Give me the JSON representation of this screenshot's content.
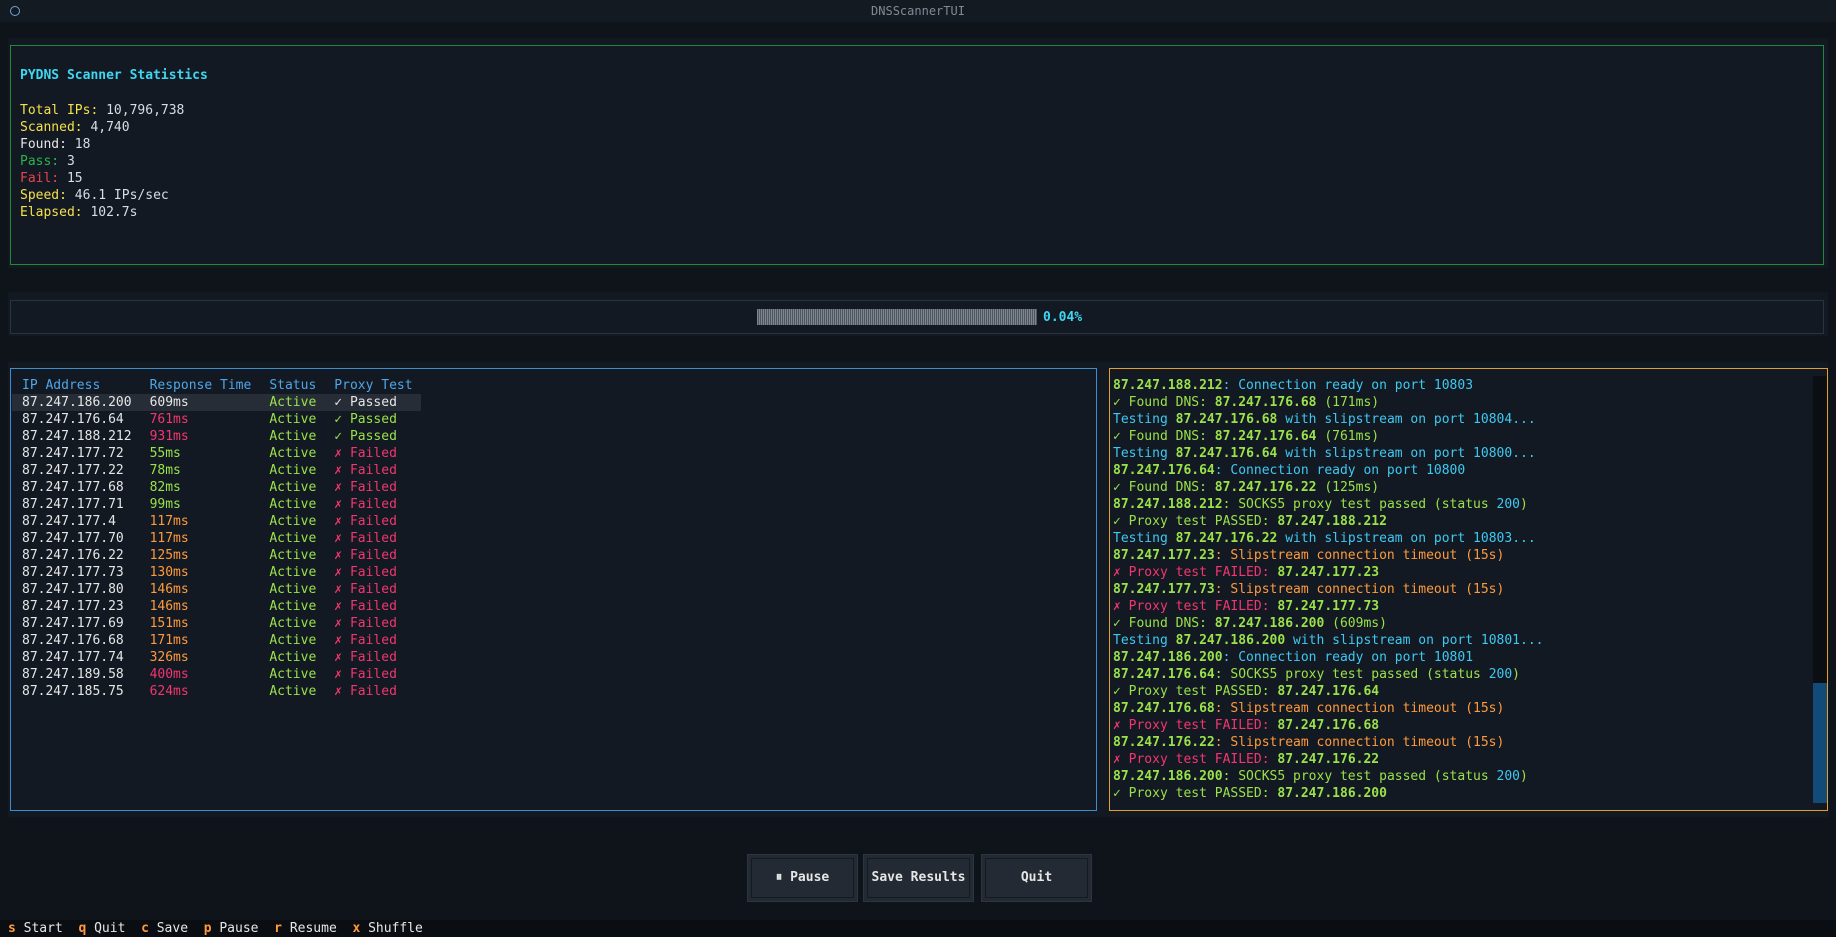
{
  "window": {
    "title": "DNSScannerTUI"
  },
  "stats": {
    "title": "PYDNS Scanner Statistics",
    "total_label": "Total IPs:",
    "total_value": "10,796,738",
    "scanned_label": "Scanned:",
    "scanned_value": "4,740",
    "found_label": "Found:",
    "found_value": "18",
    "pass_label": "Pass:",
    "pass_value": "3",
    "fail_label": "Fail:",
    "fail_value": "15",
    "speed_label": "Speed:",
    "speed_value": "46.1 IPs/sec",
    "elapsed_label": "Elapsed:",
    "elapsed_value": "102.7s"
  },
  "progress": {
    "percent_text": "0.04%",
    "fraction": 0.0004
  },
  "table": {
    "headers": [
      "IP Address",
      "Response Time",
      "Status",
      "Proxy Test"
    ],
    "rows": [
      {
        "ip": "87.247.186.200",
        "rt": "609ms",
        "rt_level": "white",
        "status": "Active",
        "proxy": "✓ Passed",
        "ok": true
      },
      {
        "ip": "87.247.176.64",
        "rt": "761ms",
        "rt_level": "red",
        "status": "Active",
        "proxy": "✓ Passed",
        "ok": true
      },
      {
        "ip": "87.247.188.212",
        "rt": "931ms",
        "rt_level": "red",
        "status": "Active",
        "proxy": "✓ Passed",
        "ok": true
      },
      {
        "ip": "87.247.177.72",
        "rt": "55ms",
        "rt_level": "green",
        "status": "Active",
        "proxy": "✗ Failed",
        "ok": false
      },
      {
        "ip": "87.247.177.22",
        "rt": "78ms",
        "rt_level": "green",
        "status": "Active",
        "proxy": "✗ Failed",
        "ok": false
      },
      {
        "ip": "87.247.177.68",
        "rt": "82ms",
        "rt_level": "green",
        "status": "Active",
        "proxy": "✗ Failed",
        "ok": false
      },
      {
        "ip": "87.247.177.71",
        "rt": "99ms",
        "rt_level": "green",
        "status": "Active",
        "proxy": "✗ Failed",
        "ok": false
      },
      {
        "ip": "87.247.177.4",
        "rt": "117ms",
        "rt_level": "orange",
        "status": "Active",
        "proxy": "✗ Failed",
        "ok": false
      },
      {
        "ip": "87.247.177.70",
        "rt": "117ms",
        "rt_level": "orange",
        "status": "Active",
        "proxy": "✗ Failed",
        "ok": false
      },
      {
        "ip": "87.247.176.22",
        "rt": "125ms",
        "rt_level": "orange",
        "status": "Active",
        "proxy": "✗ Failed",
        "ok": false
      },
      {
        "ip": "87.247.177.73",
        "rt": "130ms",
        "rt_level": "orange",
        "status": "Active",
        "proxy": "✗ Failed",
        "ok": false
      },
      {
        "ip": "87.247.177.80",
        "rt": "146ms",
        "rt_level": "orange",
        "status": "Active",
        "proxy": "✗ Failed",
        "ok": false
      },
      {
        "ip": "87.247.177.23",
        "rt": "146ms",
        "rt_level": "orange",
        "status": "Active",
        "proxy": "✗ Failed",
        "ok": false
      },
      {
        "ip": "87.247.177.69",
        "rt": "151ms",
        "rt_level": "orange",
        "status": "Active",
        "proxy": "✗ Failed",
        "ok": false
      },
      {
        "ip": "87.247.176.68",
        "rt": "171ms",
        "rt_level": "orange",
        "status": "Active",
        "proxy": "✗ Failed",
        "ok": false
      },
      {
        "ip": "87.247.177.74",
        "rt": "326ms",
        "rt_level": "orange",
        "status": "Active",
        "proxy": "✗ Failed",
        "ok": false
      },
      {
        "ip": "87.247.189.58",
        "rt": "400ms",
        "rt_level": "red",
        "status": "Active",
        "proxy": "✗ Failed",
        "ok": false
      },
      {
        "ip": "87.247.185.75",
        "rt": "624ms",
        "rt_level": "red",
        "status": "Active",
        "proxy": "✗ Failed",
        "ok": false
      }
    ]
  },
  "log": [
    [
      [
        "ip",
        "87.247.188.212"
      ],
      [
        "blue",
        ": Connection ready on port "
      ],
      [
        "num",
        "10803"
      ]
    ],
    [
      [
        "green",
        "✓ Found DNS: "
      ],
      [
        "ip",
        "87.247.176.68"
      ],
      [
        "green",
        " (171ms)"
      ]
    ],
    [
      [
        "blue",
        "Testing "
      ],
      [
        "ip",
        "87.247.176.68"
      ],
      [
        "blue",
        " with slipstream on port "
      ],
      [
        "num",
        "10804"
      ],
      [
        "blue",
        "..."
      ]
    ],
    [
      [
        "green",
        "✓ Found DNS: "
      ],
      [
        "ip",
        "87.247.176.64"
      ],
      [
        "green",
        " (761ms)"
      ]
    ],
    [
      [
        "blue",
        "Testing "
      ],
      [
        "ip",
        "87.247.176.64"
      ],
      [
        "blue",
        " with slipstream on port "
      ],
      [
        "num",
        "10800"
      ],
      [
        "blue",
        "..."
      ]
    ],
    [
      [
        "ip",
        "87.247.176.64"
      ],
      [
        "blue",
        ": Connection ready on port "
      ],
      [
        "num",
        "10800"
      ]
    ],
    [
      [
        "green",
        "✓ Found DNS: "
      ],
      [
        "ip",
        "87.247.176.22"
      ],
      [
        "green",
        " (125ms)"
      ]
    ],
    [
      [
        "ip",
        "87.247.188.212"
      ],
      [
        "green",
        ": SOCKS5 proxy test passed (status "
      ],
      [
        "num",
        "200"
      ],
      [
        "green",
        ")"
      ]
    ],
    [
      [
        "green",
        "✓ Proxy test PASSED: "
      ],
      [
        "ip",
        "87.247.188.212"
      ]
    ],
    [
      [
        "blue",
        "Testing "
      ],
      [
        "ip",
        "87.247.176.22"
      ],
      [
        "blue",
        " with slipstream on port "
      ],
      [
        "num",
        "10803"
      ],
      [
        "blue",
        "..."
      ]
    ],
    [
      [
        "ip",
        "87.247.177.23"
      ],
      [
        "orange",
        ": Slipstream connection timeout (15s)"
      ]
    ],
    [
      [
        "pink",
        "✗ Proxy test FAILED: "
      ],
      [
        "ip",
        "87.247.177.23"
      ]
    ],
    [
      [
        "ip",
        "87.247.177.73"
      ],
      [
        "orange",
        ": Slipstream connection timeout (15s)"
      ]
    ],
    [
      [
        "pink",
        "✗ Proxy test FAILED: "
      ],
      [
        "ip",
        "87.247.177.73"
      ]
    ],
    [
      [
        "green",
        "✓ Found DNS: "
      ],
      [
        "ip",
        "87.247.186.200"
      ],
      [
        "green",
        " (609ms)"
      ]
    ],
    [
      [
        "blue",
        "Testing "
      ],
      [
        "ip",
        "87.247.186.200"
      ],
      [
        "blue",
        " with slipstream on port "
      ],
      [
        "num",
        "10801"
      ],
      [
        "blue",
        "..."
      ]
    ],
    [
      [
        "ip",
        "87.247.186.200"
      ],
      [
        "blue",
        ": Connection ready on port "
      ],
      [
        "num",
        "10801"
      ]
    ],
    [
      [
        "ip",
        "87.247.176.64"
      ],
      [
        "green",
        ": SOCKS5 proxy test passed (status "
      ],
      [
        "num",
        "200"
      ],
      [
        "green",
        ")"
      ]
    ],
    [
      [
        "green",
        "✓ Proxy test PASSED: "
      ],
      [
        "ip",
        "87.247.176.64"
      ]
    ],
    [
      [
        "ip",
        "87.247.176.68"
      ],
      [
        "orange",
        ": Slipstream connection timeout (15s)"
      ]
    ],
    [
      [
        "pink",
        "✗ Proxy test FAILED: "
      ],
      [
        "ip",
        "87.247.176.68"
      ]
    ],
    [
      [
        "ip",
        "87.247.176.22"
      ],
      [
        "orange",
        ": Slipstream connection timeout (15s)"
      ]
    ],
    [
      [
        "pink",
        "✗ Proxy test FAILED: "
      ],
      [
        "ip",
        "87.247.176.22"
      ]
    ],
    [
      [
        "ip",
        "87.247.186.200"
      ],
      [
        "green",
        ": SOCKS5 proxy test passed (status "
      ],
      [
        "num",
        "200"
      ],
      [
        "green",
        ")"
      ]
    ],
    [
      [
        "green",
        "✓ Proxy test PASSED: "
      ],
      [
        "ip",
        "87.247.186.200"
      ]
    ]
  ],
  "buttons": {
    "pause": "⏸ Pause",
    "save": "Save Results",
    "quit": "Quit"
  },
  "footer": [
    {
      "key": "s",
      "label": "Start"
    },
    {
      "key": "q",
      "label": "Quit"
    },
    {
      "key": "c",
      "label": "Save"
    },
    {
      "key": "p",
      "label": "Pause"
    },
    {
      "key": "r",
      "label": "Resume"
    },
    {
      "key": "x",
      "label": "Shuffle"
    }
  ],
  "colors": {
    "accent": "#3fd6f2",
    "pass": "#9be24a",
    "fail": "#f2366f",
    "warn": "#ff9a3c",
    "stats_border": "#1f8a3a",
    "table_border": "#3d8ec9",
    "log_border": "#e0a030"
  }
}
